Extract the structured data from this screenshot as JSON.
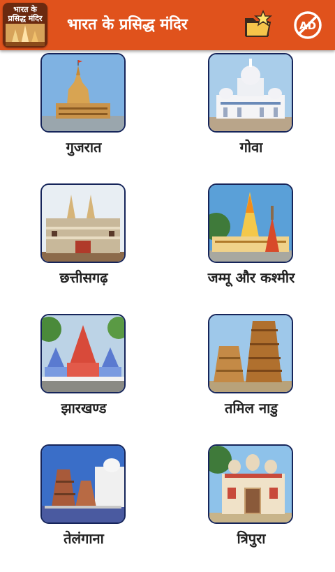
{
  "app": {
    "title": "भारत के प्रसिद्ध मंदिर",
    "logo_text_line1": "भारत के",
    "logo_text_line2": "प्रसिद्ध मंदिर",
    "logo_icon": "temple-logo",
    "actions": [
      {
        "name": "folder-star-icon"
      },
      {
        "name": "no-ads-icon",
        "text": "AD"
      }
    ]
  },
  "states": [
    {
      "label": "गुजरात"
    },
    {
      "label": "गोवा"
    },
    {
      "label": "छत्तीसगढ़"
    },
    {
      "label": "जम्मू और कश्मीर"
    },
    {
      "label": "झारखण्ड"
    },
    {
      "label": "तमिल नाडु"
    },
    {
      "label": "तेलंगाना"
    },
    {
      "label": "त्रिपुरा"
    }
  ],
  "colors": {
    "toolbar": "#e0521c",
    "tile_border": "#16255a",
    "label_text": "#222222"
  }
}
